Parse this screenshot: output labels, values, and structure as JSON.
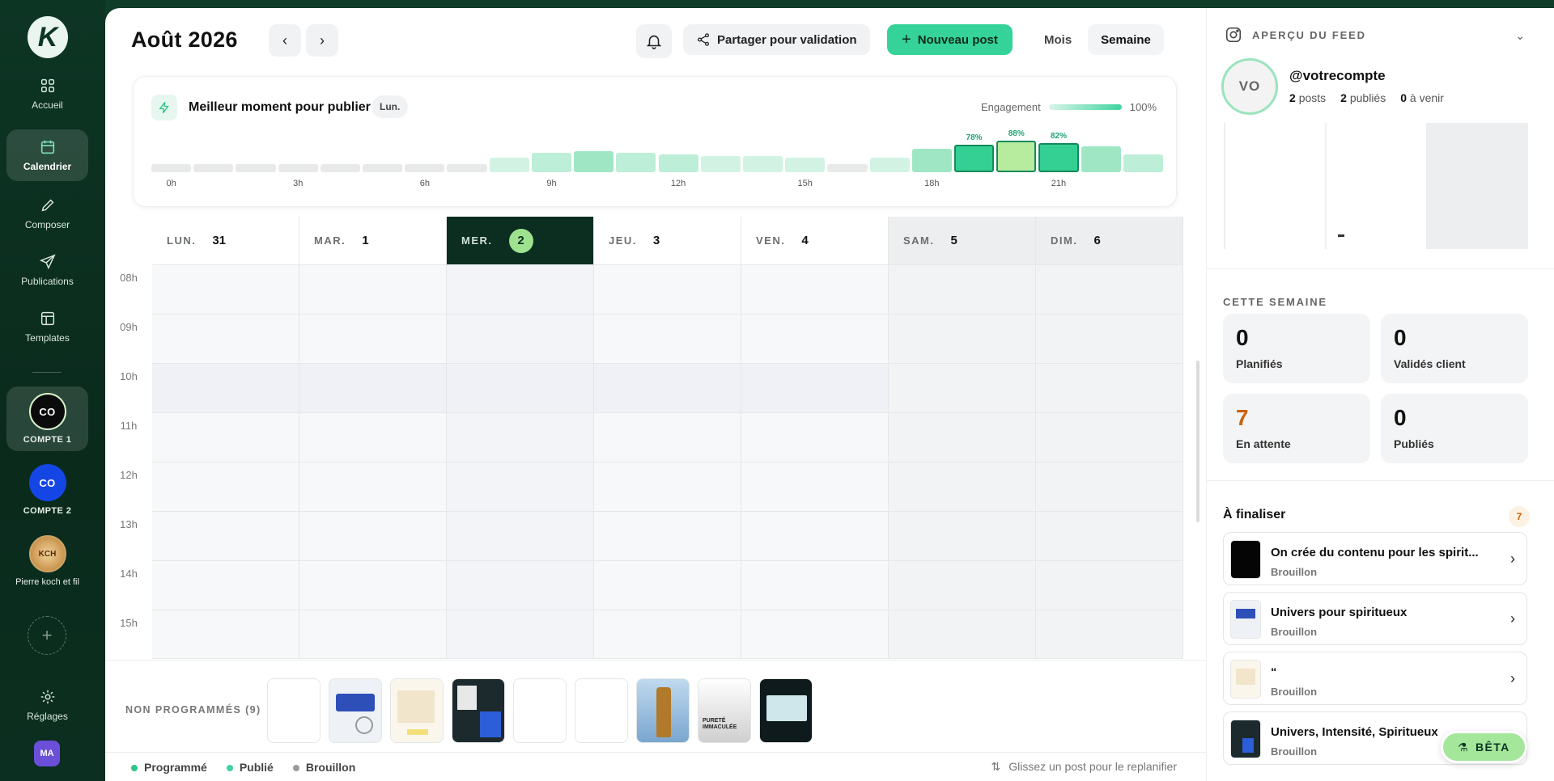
{
  "sidebar": {
    "logo": "K",
    "items": [
      {
        "label": "Accueil",
        "icon": "grid-icon"
      },
      {
        "label": "Calendrier",
        "icon": "calendar-icon"
      },
      {
        "label": "Composer",
        "icon": "pencil-icon"
      },
      {
        "label": "Publications",
        "icon": "send-icon"
      },
      {
        "label": "Templates",
        "icon": "layout-icon"
      }
    ],
    "accounts": [
      {
        "initials": "CO",
        "label": "COMPTE 1"
      },
      {
        "initials": "CO",
        "label": "COMPTE 2"
      },
      {
        "initials": "KCH",
        "label": "Pierre koch et fil"
      }
    ],
    "settings_label": "Réglages",
    "user_initials": "MA"
  },
  "header": {
    "title": "Août 2026",
    "share_label": "Partager pour validation",
    "new_post_label": "Nouveau post",
    "view_month": "Mois",
    "view_week": "Semaine"
  },
  "best_time": {
    "title": "Meilleur moment pour publier",
    "day_chip": "Lun.",
    "engagement_label": "Engagement",
    "engagement_max": "100%",
    "hour_labels": [
      "0h",
      "3h",
      "6h",
      "9h",
      "12h",
      "15h",
      "18h",
      "21h"
    ],
    "values": [
      0.05,
      0.05,
      0.05,
      0.05,
      0.05,
      0.05,
      0.05,
      0.08,
      0.4,
      0.55,
      0.6,
      0.55,
      0.5,
      0.45,
      0.45,
      0.4,
      0.1,
      0.4,
      0.65,
      0.78,
      0.88,
      0.82,
      0.72,
      0.5
    ],
    "top_labels": [
      "78%",
      "88%",
      "82%"
    ]
  },
  "calendar": {
    "days": [
      {
        "name": "LUN.",
        "date": "31"
      },
      {
        "name": "MAR.",
        "date": "1"
      },
      {
        "name": "MER.",
        "date": "2"
      },
      {
        "name": "JEU.",
        "date": "3"
      },
      {
        "name": "VEN.",
        "date": "4"
      },
      {
        "name": "SAM.",
        "date": "5"
      },
      {
        "name": "DIM.",
        "date": "6"
      }
    ],
    "hours": [
      "08h",
      "09h",
      "10h",
      "11h",
      "12h",
      "13h",
      "14h",
      "15h"
    ]
  },
  "unscheduled": {
    "label": "NON PROGRAMMÉS (9)",
    "thumb_text": "PURETÉ IMMACULÉE"
  },
  "legend": {
    "scheduled": "Programmé",
    "published": "Publié",
    "draft": "Brouillon",
    "hint": "Glissez un post pour le replanifier",
    "colors": {
      "scheduled": "#2cc58a",
      "published": "#3fd49f",
      "draft": "#9a9c9b"
    }
  },
  "feed": {
    "header": "APERÇU DU FEED",
    "avatar": "VO",
    "handle": "@votrecompte",
    "posts_count": "2",
    "posts_label": "posts",
    "published_count": "2",
    "published_label": "publiés",
    "upcoming_count": "0",
    "upcoming_label": "à venir"
  },
  "week_stats": {
    "header": "CETTE SEMAINE",
    "items": [
      {
        "value": "0",
        "label": "Planifiés"
      },
      {
        "value": "0",
        "label": "Validés client"
      },
      {
        "value": "7",
        "label": "En attente"
      },
      {
        "value": "0",
        "label": "Publiés"
      }
    ]
  },
  "to_finalize": {
    "title": "À finaliser",
    "count": "7",
    "items": [
      {
        "name": "On crée du contenu pour les spirit...",
        "status": "Brouillon"
      },
      {
        "name": "Univers pour spiritueux",
        "status": "Brouillon"
      },
      {
        "name": "“",
        "status": "Brouillon"
      },
      {
        "name": "Univers, Intensité, Spiritueux",
        "status": "Brouillon"
      }
    ]
  },
  "beta_label": "BÊTA"
}
